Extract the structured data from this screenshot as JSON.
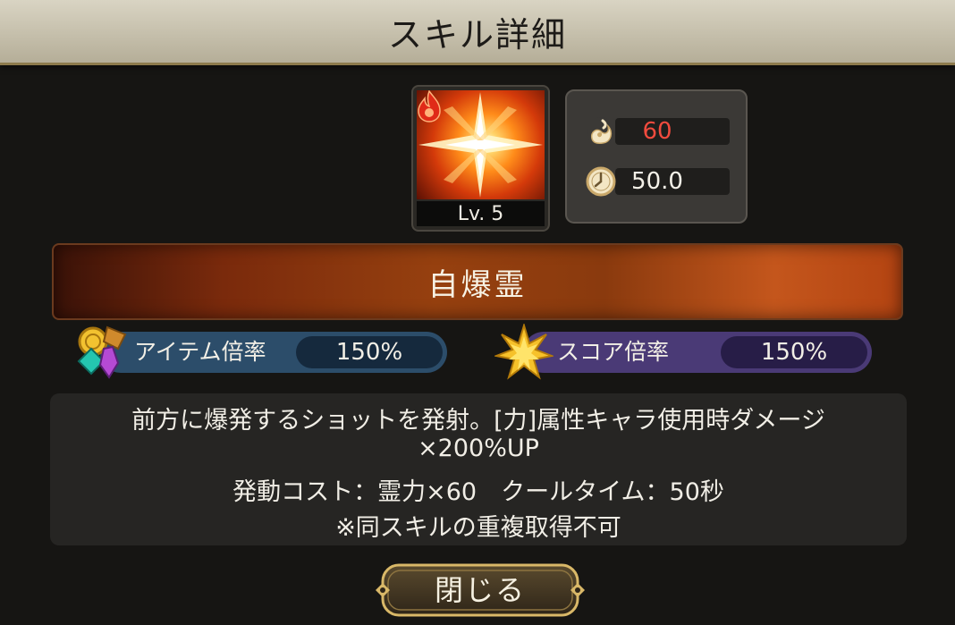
{
  "header": {
    "title": "スキル詳細"
  },
  "skill": {
    "level_label": "Lv. 5",
    "element_icon": "fire-icon",
    "name": "自爆霊"
  },
  "stats": {
    "spirit_cost": "60",
    "cooldown": "50.0",
    "spirit_icon": "spirit-flame-icon",
    "cooldown_icon": "clock-icon",
    "colors": {
      "cost": "#f14b3e"
    }
  },
  "multipliers": {
    "item": {
      "label": "アイテム倍率",
      "value": "150%",
      "icon": "gems-icon"
    },
    "score": {
      "label": "スコア倍率",
      "value": "150%",
      "icon": "star-icon"
    }
  },
  "description": {
    "line1": "前方に爆発するショットを発射。[力]属性キャラ使用時ダメージ",
    "line2": "×200%UP",
    "line3": "発動コスト：霊力×60　クールタイム：50秒",
    "line4": "※同スキルの重複取得不可"
  },
  "buttons": {
    "close": "閉じる"
  }
}
